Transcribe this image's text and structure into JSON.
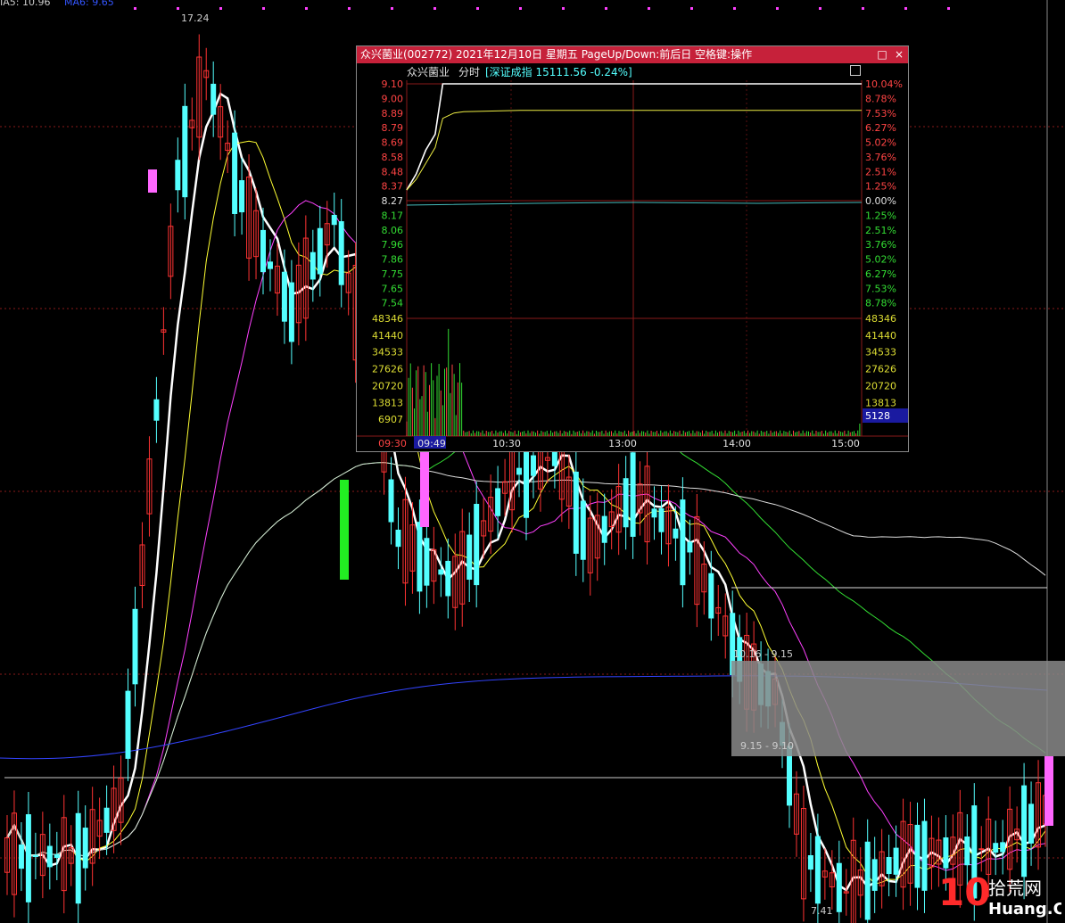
{
  "main": {
    "top_label_a": "IA5: 10.96",
    "top_label_b": "MA6: 9.65",
    "high_label": "17.24",
    "low_label": "7.41",
    "box_label_top": "10.16 - 9.15",
    "box_label_bottom": "9.15 - 9.10",
    "colors": {
      "up": "#ff3333",
      "down": "#54ffff",
      "ma5": "#ffffff",
      "ma10": "#ffff33",
      "ma20": "#ff40ff",
      "ma60": "#33dd33",
      "ma120": "#dddddd",
      "ma250": "#3344ff",
      "grid": "#8a1a1a",
      "box": "#8a8a8a"
    }
  },
  "popup": {
    "title": "众兴菌业(002772) 2021年12月10日 星期五 PageUp/Down:前后日 空格键:操作",
    "stock_name": "众兴菌业",
    "mode_label": "分时",
    "index_label": "[深证成指 15111.56 -0.24%]",
    "minimize_icon": "□",
    "close_icon": "×",
    "price_ticks": [
      "9.10",
      "9.00",
      "8.89",
      "8.79",
      "8.69",
      "8.58",
      "8.48",
      "8.37",
      "8.27",
      "8.17",
      "8.06",
      "7.96",
      "7.86",
      "7.75",
      "7.65",
      "7.54"
    ],
    "pct_ticks": [
      "10.04%",
      "8.78%",
      "7.53%",
      "6.27%",
      "5.02%",
      "3.76%",
      "2.51%",
      "1.25%",
      "0.00%",
      "1.25%",
      "2.51%",
      "3.76%",
      "5.02%",
      "6.27%",
      "7.53%",
      "8.78%"
    ],
    "volume_ticks": [
      "48346",
      "41440",
      "34533",
      "27626",
      "20720",
      "13813",
      "6907"
    ],
    "volume_right_ticks": [
      "48346",
      "41440",
      "34533",
      "27626",
      "20720",
      "13813"
    ],
    "last_volume": "5128",
    "time_labels": [
      "09:30",
      "09:49",
      "10:30",
      "13:00",
      "14:00",
      "15:00"
    ]
  },
  "chart_data": [
    {
      "type": "candlestick",
      "title": "",
      "note": "Daily K-line with MA5/MA10/MA20/MA60/MA120/MA250",
      "annotations": {
        "high": 17.24,
        "low": 7.41,
        "zone_top": "10.16 - 9.15",
        "zone_bottom": "9.15 - 9.10"
      },
      "ylim": [
        6.8,
        17.6
      ]
    },
    {
      "type": "line",
      "title": "众兴菌业(002772) 分时",
      "x": [
        "09:30",
        "09:35",
        "09:40",
        "09:45",
        "09:49",
        "09:55",
        "10:00",
        "10:30",
        "11:30",
        "13:00",
        "14:00",
        "15:00"
      ],
      "price": [
        8.3,
        8.42,
        8.6,
        8.72,
        9.1,
        9.1,
        9.1,
        9.1,
        9.1,
        9.1,
        9.1,
        9.1
      ],
      "avg_price": [
        8.3,
        8.38,
        8.5,
        8.62,
        8.84,
        8.88,
        8.89,
        8.9,
        8.9,
        8.9,
        8.9,
        8.9
      ],
      "prev_close": 8.27,
      "ylim": [
        7.44,
        9.1
      ],
      "volume_ylim": [
        0,
        48346
      ],
      "last_volume": 5128
    }
  ]
}
